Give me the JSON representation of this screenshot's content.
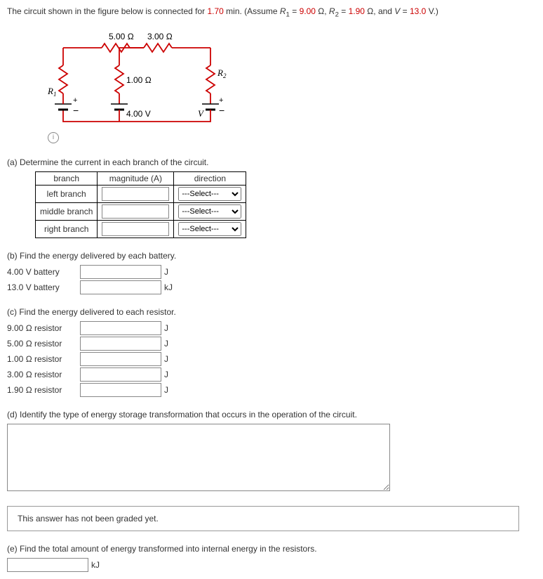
{
  "intro": {
    "prefix": "The circuit shown in the figure below is connected for ",
    "time": "1.70",
    "mid1": " min. (Assume ",
    "r1lbl": "R",
    "r1sub": "1",
    "eq1": " = ",
    "r1val": "9.00",
    "ohm": " Ω, ",
    "r2lbl": "R",
    "r2sub": "2",
    "eq2": " = ",
    "r2val": "1.90",
    "ohm2": " Ω, and ",
    "vlabel": "V",
    "eq3": " = ",
    "vval": "13.0",
    "vunit": " V.)"
  },
  "circuit": {
    "top_r1": "5.00 Ω",
    "top_r2": "3.00 Ω",
    "mid_r": "1.00 Ω",
    "left_r": "R",
    "left_r_sub": "1",
    "right_r": "R",
    "right_r_sub": "2",
    "batt1": "4.00 V",
    "batt2": "V",
    "plus": "+",
    "minus": "−"
  },
  "a": {
    "q": "(a) Determine the current in each branch of the circuit.",
    "h1": "branch",
    "h2": "magnitude (A)",
    "h3": "direction",
    "rows": [
      {
        "label": "left branch"
      },
      {
        "label": "middle branch"
      },
      {
        "label": "right branch"
      }
    ],
    "select_opt": "---Select---"
  },
  "b": {
    "q": "(b) Find the energy delivered by each battery.",
    "rows": [
      {
        "label": "4.00 V battery",
        "unit": "J"
      },
      {
        "label": "13.0 V battery",
        "unit": "kJ"
      }
    ]
  },
  "c": {
    "q": "(c) Find the energy delivered to each resistor.",
    "rows": [
      {
        "label": "9.00 Ω resistor",
        "unit": "J"
      },
      {
        "label": "5.00 Ω resistor",
        "unit": "J"
      },
      {
        "label": "1.00 Ω resistor",
        "unit": "J"
      },
      {
        "label": "3.00 Ω resistor",
        "unit": "J"
      },
      {
        "label": "1.90 Ω resistor",
        "unit": "J"
      }
    ]
  },
  "d": {
    "q": "(d) Identify the type of energy storage transformation that occurs in the operation of the circuit."
  },
  "grade": "This answer has not been graded yet.",
  "e": {
    "q": "(e) Find the total amount of energy transformed into internal energy in the resistors.",
    "unit": "kJ"
  }
}
